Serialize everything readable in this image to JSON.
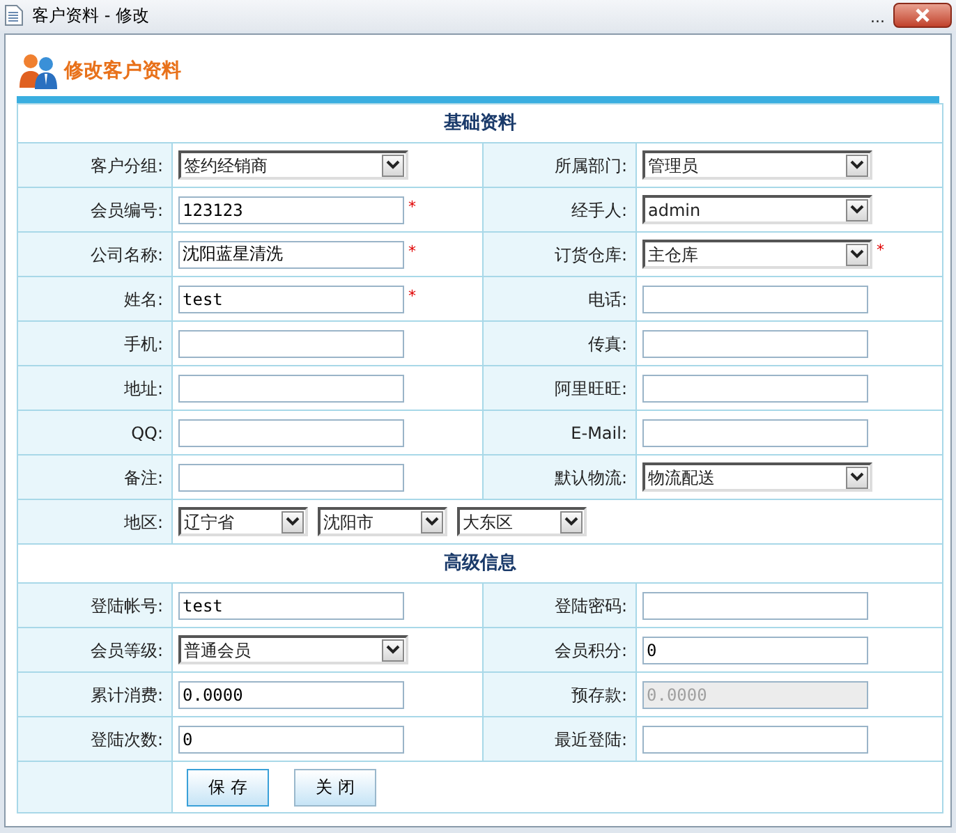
{
  "window": {
    "title": "客户资料 - 修改",
    "overflow": "..."
  },
  "heading": "修改客户资料",
  "sections": [
    {
      "title": "基础资料",
      "rows": [
        {
          "cells": [
            {
              "label": "客户分组:",
              "fields": [
                {
                  "kind": "select",
                  "value": "签约经销商",
                  "disabled": false
                }
              ]
            },
            {
              "label": "所属部门:",
              "fields": [
                {
                  "kind": "select",
                  "value": "管理员",
                  "disabled": false
                }
              ]
            }
          ]
        },
        {
          "cells": [
            {
              "label": "会员编号:",
              "fields": [
                {
                  "kind": "text",
                  "value": "123123",
                  "required_mark": "*",
                  "disabled": false
                }
              ]
            },
            {
              "label": "经手人:",
              "fields": [
                {
                  "kind": "select",
                  "value": "admin",
                  "disabled": false
                }
              ]
            }
          ]
        },
        {
          "cells": [
            {
              "label": "公司名称:",
              "fields": [
                {
                  "kind": "text",
                  "value": "沈阳蓝星清洗",
                  "required_mark": "*",
                  "disabled": false
                }
              ]
            },
            {
              "label": "订货仓库:",
              "fields": [
                {
                  "kind": "select",
                  "value": "主仓库",
                  "required_mark": "*",
                  "disabled": false
                }
              ]
            }
          ]
        },
        {
          "cells": [
            {
              "label": "姓名:",
              "fields": [
                {
                  "kind": "text",
                  "value": "test",
                  "required_mark": "*",
                  "disabled": false
                }
              ]
            },
            {
              "label": "电话:",
              "fields": [
                {
                  "kind": "text",
                  "disabled": false
                }
              ]
            }
          ]
        },
        {
          "cells": [
            {
              "label": "手机:",
              "fields": [
                {
                  "kind": "text",
                  "disabled": false
                }
              ]
            },
            {
              "label": "传真:",
              "fields": [
                {
                  "kind": "text",
                  "disabled": false
                }
              ]
            }
          ]
        },
        {
          "cells": [
            {
              "label": "地址:",
              "fields": [
                {
                  "kind": "text",
                  "disabled": false
                }
              ]
            },
            {
              "label": "阿里旺旺:",
              "fields": [
                {
                  "kind": "text",
                  "disabled": false
                }
              ]
            }
          ]
        },
        {
          "cells": [
            {
              "label": "QQ:",
              "fields": [
                {
                  "kind": "text",
                  "disabled": false
                }
              ]
            },
            {
              "label": "E-Mail:",
              "fields": [
                {
                  "kind": "text",
                  "disabled": false
                }
              ]
            }
          ]
        },
        {
          "cells": [
            {
              "label": "备注:",
              "fields": [
                {
                  "kind": "text",
                  "disabled": false
                }
              ]
            },
            {
              "label": "默认物流:",
              "fields": [
                {
                  "kind": "select",
                  "value": "物流配送",
                  "disabled": false
                }
              ]
            }
          ]
        },
        {
          "cells": [
            {
              "label": "地区:",
              "fields": [
                {
                  "kind": "small-select",
                  "value": "辽宁省",
                  "disabled": false
                },
                {
                  "kind": "small-select",
                  "value": "沈阳市",
                  "disabled": false
                },
                {
                  "kind": "small-select",
                  "value": "大东区",
                  "disabled": false
                }
              ]
            }
          ]
        }
      ]
    },
    {
      "title": "高级信息",
      "rows": [
        {
          "cells": [
            {
              "label": "登陆帐号:",
              "fields": [
                {
                  "kind": "text",
                  "value": "test",
                  "disabled": false
                }
              ]
            },
            {
              "label": "登陆密码:",
              "fields": [
                {
                  "kind": "text",
                  "disabled": false
                }
              ]
            }
          ]
        },
        {
          "cells": [
            {
              "label": "会员等级:",
              "fields": [
                {
                  "kind": "select",
                  "value": "普通会员",
                  "disabled": false
                }
              ]
            },
            {
              "label": "会员积分:",
              "fields": [
                {
                  "kind": "text",
                  "value": "0",
                  "disabled": false
                }
              ]
            }
          ]
        },
        {
          "cells": [
            {
              "label": "累计消费:",
              "fields": [
                {
                  "kind": "text",
                  "value": "0.0000",
                  "disabled": false
                }
              ]
            },
            {
              "label": "预存款:",
              "fields": [
                {
                  "kind": "text",
                  "value": "0.0000",
                  "disabled": true
                }
              ]
            }
          ]
        },
        {
          "cells": [
            {
              "label": "登陆次数:",
              "fields": [
                {
                  "kind": "text",
                  "value": "0",
                  "disabled": false
                }
              ]
            },
            {
              "label": "最近登陆:",
              "fields": [
                {
                  "kind": "text",
                  "disabled": false
                }
              ]
            }
          ]
        }
      ]
    }
  ],
  "buttons": [
    "保 存",
    "关 闭"
  ]
}
